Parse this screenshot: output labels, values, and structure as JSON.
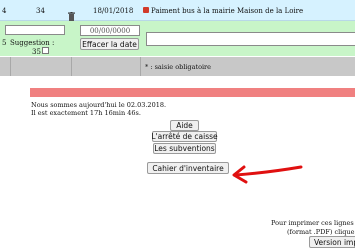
{
  "row": {
    "number": "4",
    "qty": "34",
    "date": "18/01/2018",
    "desc": "Paiment bus à la mairie Maison de la Loire"
  },
  "edit_row": {
    "number": "5",
    "suggestion_label": "Suggestion :",
    "suggestion_value": "35",
    "date_placeholder": "00/00/0000",
    "clear_date_label": "Effacer la date",
    "desc_value": ""
  },
  "required_note": "* : saisie obligatoire",
  "info": {
    "today": "Nous sommes aujourd'hui le 02.03.2018.",
    "time": "Il est exactement 17h 16min 46s."
  },
  "buttons": {
    "aide": "Aide",
    "caisse": "L'arrêté de caisse",
    "subventions": "Les subventions",
    "inventaire": "Cahier d'inventaire"
  },
  "print": {
    "line1": "Pour imprimer ces lignes d'é",
    "line2": "(format .PDF) clique s",
    "button": "Version impri"
  },
  "colors": {
    "row_bg": "#d6f2ff",
    "edit_bg": "#c8f5c8",
    "grey_bar": "#c8c8c8",
    "red_bar": "#f08080",
    "arrow": "#e01010"
  }
}
